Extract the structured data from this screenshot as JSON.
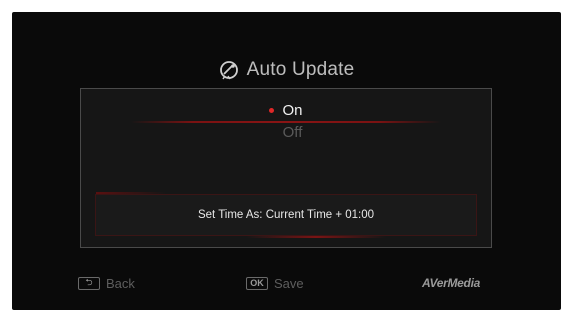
{
  "dialog": {
    "title": "Auto Update",
    "title_icon": "satellite-dish-icon",
    "options": [
      {
        "label": "On",
        "selected": true
      },
      {
        "label": "Off",
        "selected": false
      }
    ],
    "time_setting": "Set Time As: Current Time + 01:00"
  },
  "footer": {
    "back_key": "⮌",
    "back_label": "Back",
    "ok_key": "OK",
    "save_label": "Save",
    "brand": "AVerMedia"
  },
  "colors": {
    "background": "#0a0a0a",
    "accent": "#e02828",
    "text_selected": "#f2f2f2",
    "text_dim": "#5a5a5a"
  }
}
